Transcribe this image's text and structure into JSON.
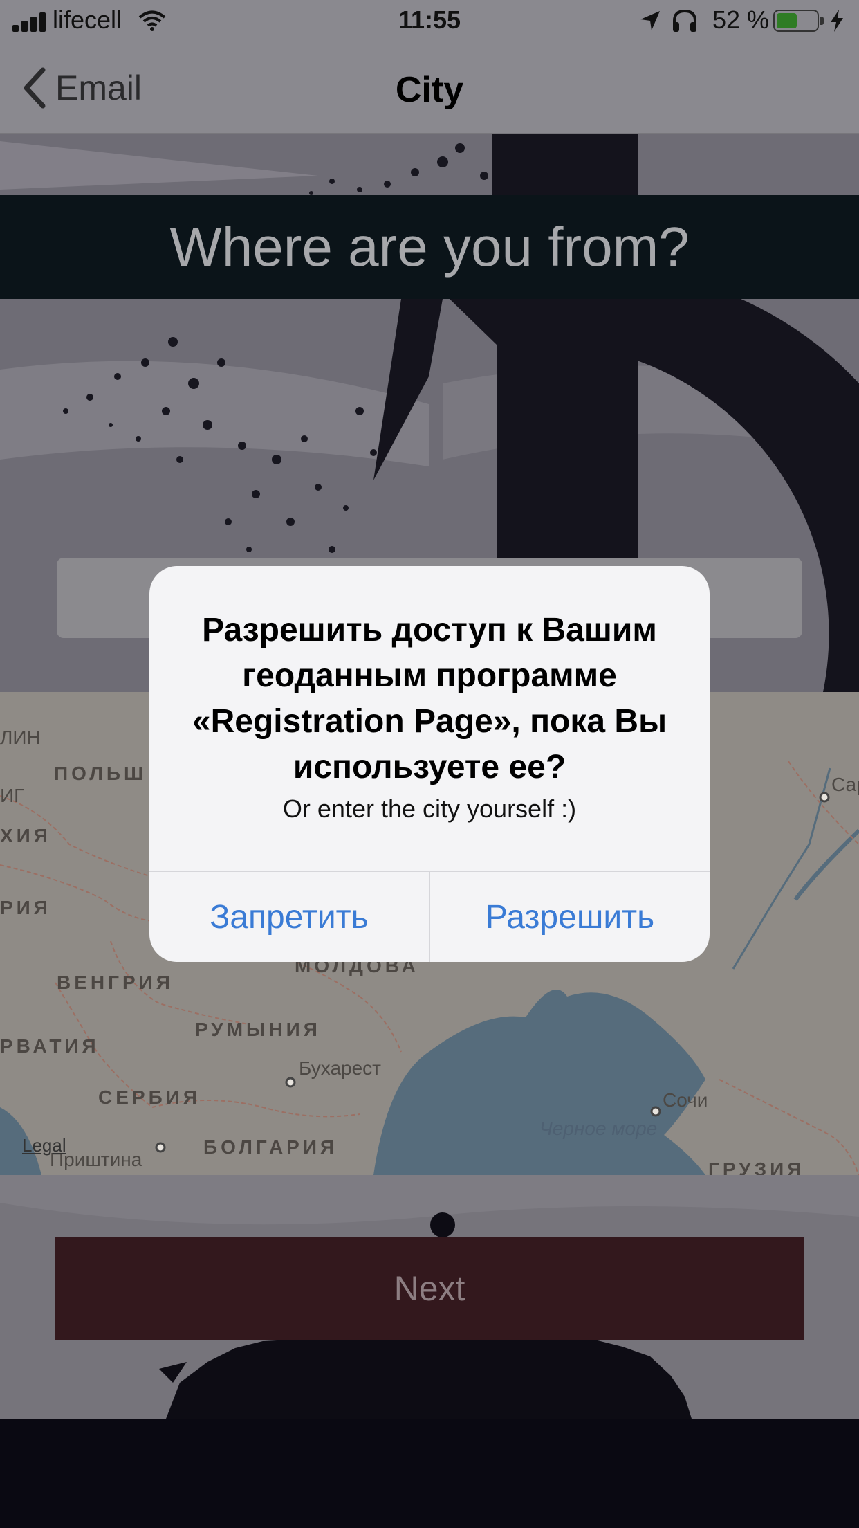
{
  "status_bar": {
    "carrier": "lifecell",
    "time": "11:55",
    "battery_percent": "52 %",
    "battery_level": 0.52,
    "icons": [
      "signal-icon",
      "wifi-icon",
      "location-arrow-icon",
      "headphones-icon",
      "battery-icon",
      "charging-icon"
    ]
  },
  "nav": {
    "back_label": "Email",
    "title": "City"
  },
  "main": {
    "question": "Where are you from?",
    "city_input_placeholder": "",
    "next_button": "Next"
  },
  "map": {
    "countries": [
      "ПОЛЬШ",
      "ХИЯ",
      "РИЯ",
      "ВЕНГРИЯ",
      "МОЛДОВА",
      "РУМЫНИЯ",
      "РВАТИЯ",
      "СЕРБИЯ",
      "БОЛГАРИЯ",
      "ГРУЗИЯ"
    ],
    "cities": [
      "ЛИН",
      "ИГ",
      "Бухарест",
      "Приштина",
      "Сочи",
      "Сар"
    ],
    "sea": "Черное море",
    "legal": "Legal"
  },
  "alert": {
    "title": "Разрешить доступ к Вашим геоданным программе «Registration Page», пока Вы используете ее?",
    "message": "Or enter the city yourself :)",
    "deny_button": "Запретить",
    "allow_button": "Разрешить"
  },
  "colors": {
    "alert_button": "#3a7bd5",
    "next_button_bg": "#33181d",
    "banner_bg": "#0b1419"
  }
}
